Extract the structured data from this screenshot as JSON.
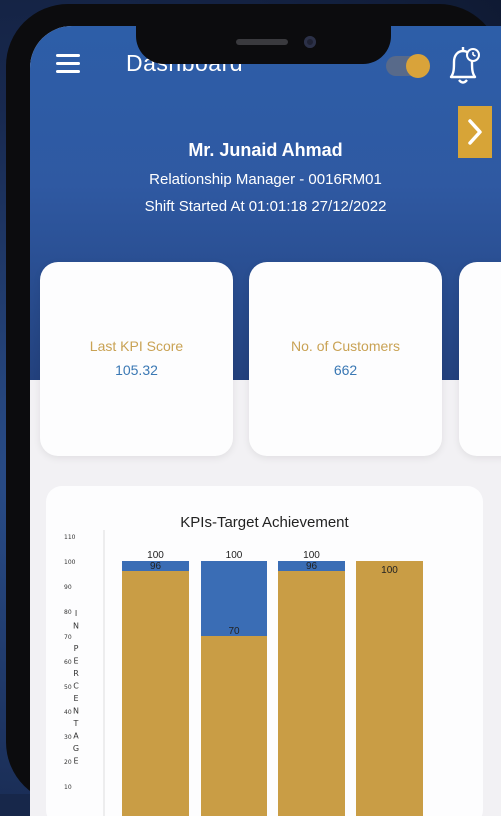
{
  "header": {
    "title": "Dashboard"
  },
  "profile": {
    "name": "Mr. Junaid Ahmad",
    "role": "Relationship Manager - 0016RM01",
    "shift": "Shift Started At 01:01:18 27/12/2022"
  },
  "cards": [
    {
      "label": "Last KPI Score",
      "value": "105.32"
    },
    {
      "label": "No. of Customers",
      "value": "662"
    }
  ],
  "colors": {
    "gold": "#c99d45",
    "blue": "#3a6db5",
    "hero": "#2f59a2"
  },
  "chart_data": {
    "type": "bar",
    "title": "KPIs-Target Achievement",
    "ylabel": "IN PERCENTAGE",
    "ylim": [
      0,
      110
    ],
    "yticks": [
      110,
      100,
      90,
      80,
      70,
      60,
      50,
      40,
      30,
      20,
      10
    ],
    "series": [
      {
        "values": [
          96,
          70,
          96,
          100
        ],
        "color": "#c99d45"
      },
      {
        "values": [
          100,
          100,
          100,
          null
        ],
        "color": "#3a6db5"
      }
    ],
    "labels": {
      "top": [
        "100",
        "100",
        "100",
        "100"
      ],
      "inner": [
        "96",
        "70",
        "96",
        ""
      ]
    }
  }
}
